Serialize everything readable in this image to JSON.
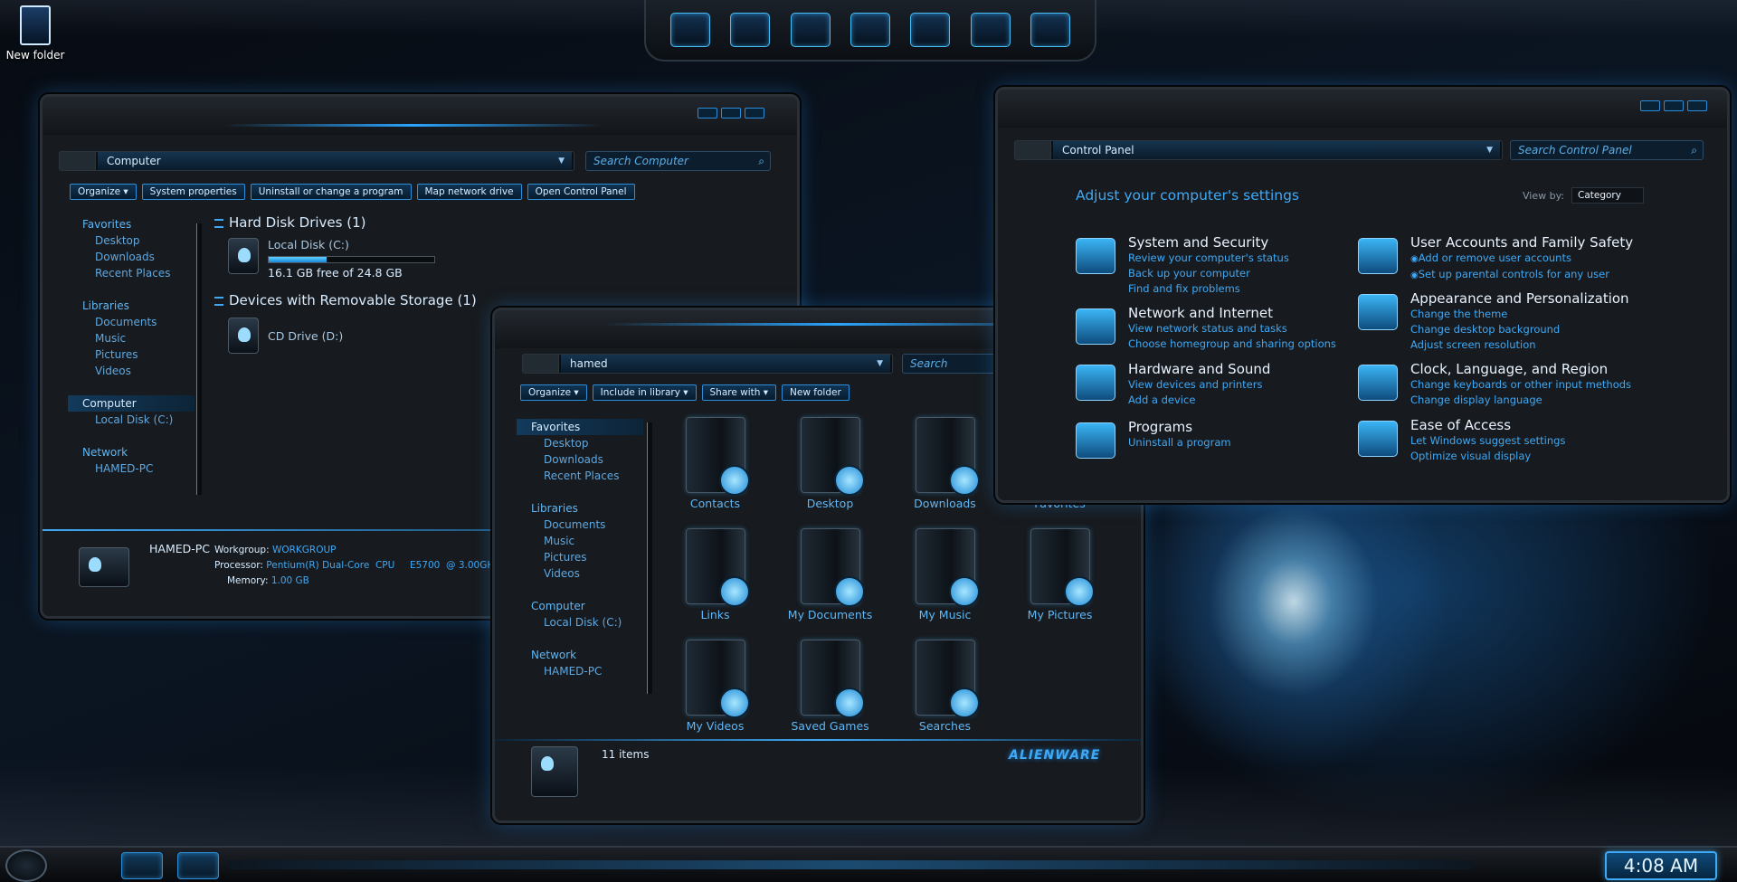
{
  "desktop": {
    "icon_label": "New folder"
  },
  "computer_window": {
    "address": "Computer",
    "search_placeholder": "Search Computer",
    "toolbar": [
      "Organize ▾",
      "System properties",
      "Uninstall or change a program",
      "Map network drive",
      "Open Control Panel"
    ],
    "nav": {
      "favorites": "Favorites",
      "desktop": "Desktop",
      "downloads": "Downloads",
      "recent": "Recent Places",
      "libraries": "Libraries",
      "documents": "Documents",
      "music": "Music",
      "pictures": "Pictures",
      "videos": "Videos",
      "computer": "Computer",
      "local_disk": "Local Disk (C:)",
      "network": "Network",
      "pc": "HAMED-PC"
    },
    "hdd_header": "Hard Disk Drives (1)",
    "local_disk_name": "Local Disk (C:)",
    "local_disk_free": "16.1 GB free of 24.8 GB",
    "local_disk_used_fraction": 0.35,
    "removable_header": "Devices with Removable Storage (1)",
    "cd_name": "CD Drive (D:)",
    "details": {
      "name": "HAMED-PC",
      "workgroup_label": "Workgroup:",
      "workgroup": "WORKGROUP",
      "processor_label": "Processor:",
      "processor": "Pentium(R) Dual-Core  CPU     E5700  @ 3.00GHz",
      "memory_label": "Memory:",
      "memory": "1.00 GB"
    }
  },
  "hamed_window": {
    "address": "hamed",
    "search_placeholder": "Search",
    "toolbar": [
      "Organize ▾",
      "Include in library ▾",
      "Share with ▾",
      "New folder"
    ],
    "nav": {
      "favorites": "Favorites",
      "desktop": "Desktop",
      "downloads": "Downloads",
      "recent": "Recent Places",
      "libraries": "Libraries",
      "documents": "Documents",
      "music": "Music",
      "pictures": "Pictures",
      "videos": "Videos",
      "computer": "Computer",
      "local_disk": "Local Disk (C:)",
      "network": "Network",
      "pc": "HAMED-PC"
    },
    "items": [
      "Contacts",
      "Desktop",
      "Downloads",
      "Favorites",
      "Links",
      "My Documents",
      "My Music",
      "My Pictures",
      "My Videos",
      "Saved Games",
      "Searches"
    ],
    "status": "11 items",
    "brand": "ALIENWARE"
  },
  "control_panel": {
    "address": "Control Panel",
    "search_placeholder": "Search Control Panel",
    "title": "Adjust your computer's settings",
    "view_by_label": "View by:",
    "view_by_value": "Category",
    "left": [
      {
        "title": "System and Security",
        "links": [
          "Review your computer's status",
          "Back up your computer",
          "Find and fix problems"
        ]
      },
      {
        "title": "Network and Internet",
        "links": [
          "View network status and tasks",
          "Choose homegroup and sharing options"
        ]
      },
      {
        "title": "Hardware and Sound",
        "links": [
          "View devices and printers",
          "Add a device"
        ]
      },
      {
        "title": "Programs",
        "links": [
          "Uninstall a program"
        ]
      }
    ],
    "right": [
      {
        "title": "User Accounts and Family Safety",
        "links": [
          "Add or remove user accounts",
          "Set up parental controls for any user"
        ]
      },
      {
        "title": "Appearance and Personalization",
        "links": [
          "Change the theme",
          "Change desktop background",
          "Adjust screen resolution"
        ]
      },
      {
        "title": "Clock, Language, and Region",
        "links": [
          "Change keyboards or other input methods",
          "Change display language"
        ]
      },
      {
        "title": "Ease of Access",
        "links": [
          "Let Windows suggest settings",
          "Optimize visual display"
        ]
      }
    ]
  },
  "taskbar": {
    "time": "4:08 AM"
  },
  "colors": {
    "accent": "#3fa9f5",
    "frame": "#171a1e"
  }
}
